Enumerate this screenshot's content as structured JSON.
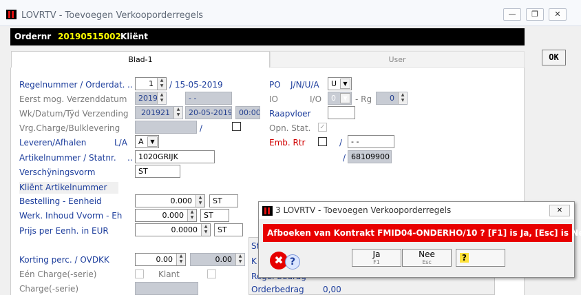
{
  "window": {
    "title": "LOVRTV - Toevoegen Verkooporderregels"
  },
  "infobar": {
    "ordernr_label": "Ordernr",
    "ordernr": "20190515002",
    "client_label": "Kliënt"
  },
  "tabs": [
    {
      "label": "Blad-1"
    },
    {
      "label": "User"
    }
  ],
  "ok_label": "OK",
  "form": {
    "regelnummer_label": "Regelnummer / Orderdat.",
    "dots1": "..",
    "regelnummer": "1",
    "orderdatum": "/ 15-05-2019",
    "eerst_label": "Eerst mog. Verzenddatum",
    "eerst_week": "201900",
    "eerst_date": "- -",
    "wk_label": "Wk/Datum/Tÿd Verzending",
    "wk_week": "201921",
    "wk_date": "20-05-2019",
    "wk_time": "00:00",
    "vrg_label": "Vrg.Charge/Bulklevering",
    "slash": "/",
    "leveren_label": "Leveren/Afhalen",
    "la_label": "L/A",
    "la_value": "A",
    "artikel_label": "Artikelnummer / Statnr.",
    "dots2": "..",
    "artikel_value": "1020GRIJK",
    "verschijning_label": "Verschÿningsvorm",
    "verschijning_value": "ST",
    "klient_art_label": "Kliënt Artikelnummer",
    "bestelling_label": "Bestelling - Eenheid",
    "bestelling_value": "0.000",
    "bestelling_unit": "ST",
    "werk_label": "Werk. Inhoud Vvorm - Eh",
    "werk_value": "0.000",
    "werk_unit": "ST",
    "prijs_label": "Prijs per Eenh. in EUR",
    "prijs_value": "0.0000",
    "prijs_unit": "ST",
    "korting_label": "Korting perc. / OVDKK",
    "korting_value": "0.00",
    "ovdkk_value": "0.00",
    "een_label": "Eén Charge(-serie)",
    "klant_label": "Klant",
    "charge_label": "Charge(-serie)",
    "po_label": "PO",
    "po_sub": "J/N/U/A",
    "po_value": "U",
    "io_label": "IO",
    "io_sub": "I/O",
    "io_value": "0",
    "rg_label": "- Rg",
    "rg_value": "0",
    "raapvloer_label": "Raapvloer",
    "opn_label": "Opn. Stat.",
    "emb_label": "Emb. Rtr",
    "emb_slash": "/",
    "emb_value": "- -",
    "stat_slash": "/",
    "stat_value": "68109900",
    "st_partial": "St",
    "k_partial": "K",
    "regel_partial": "Regel bedrag",
    "orderbedrag_label": "Orderbedrag",
    "orderbedrag_value": "0,00"
  },
  "dialog": {
    "title": "3 LOVRTV - Toevoegen Verkooporderregels",
    "message": "Afboeken van Kontrakt FMID04-ONDERHO/10 ?  [F1] is Ja, [Esc] is Nee",
    "ja_label": "Ja",
    "ja_key": "F1",
    "nee_label": "Nee",
    "nee_key": "Esc",
    "help_label": "?"
  },
  "colors": {
    "label_blue": "#1c3d9c",
    "alert_red": "#e80000",
    "accent_yellow": "#ffff00"
  }
}
